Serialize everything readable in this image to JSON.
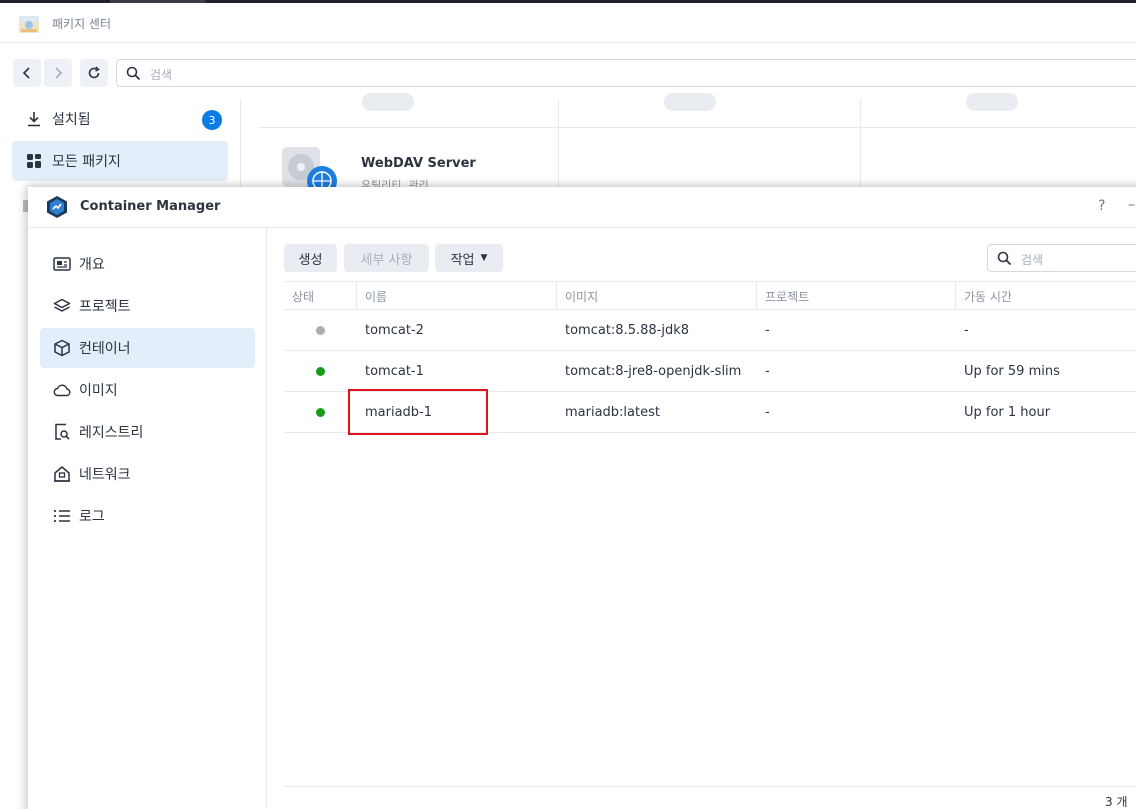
{
  "package_center": {
    "title": "패키지 센터",
    "search_placeholder": "검색",
    "sidebar": [
      {
        "label": "설치됨",
        "icon": "download-icon",
        "badge": "3"
      },
      {
        "label": "모든 패키지",
        "icon": "grid-icon",
        "active": true
      }
    ],
    "package": {
      "name": "WebDAV Server",
      "category": "유틸리티, 관리"
    }
  },
  "container_manager": {
    "title": "Container Manager",
    "help_label": "?",
    "minimize_label": "–",
    "sidebar": [
      {
        "label": "개요",
        "icon": "overview-card-icon"
      },
      {
        "label": "프로젝트",
        "icon": "layers-icon"
      },
      {
        "label": "컨테이너",
        "icon": "cube-icon",
        "active": true
      },
      {
        "label": "이미지",
        "icon": "cloud-icon"
      },
      {
        "label": "레지스트리",
        "icon": "registry-search-icon"
      },
      {
        "label": "네트워크",
        "icon": "network-house-icon"
      },
      {
        "label": "로그",
        "icon": "list-icon"
      }
    ],
    "toolbar": {
      "create_label": "생성",
      "details_label": "세부 사항",
      "action_label": "작업",
      "search_placeholder": "검색"
    },
    "table": {
      "columns": [
        "상태",
        "이름",
        "이미지",
        "프로젝트",
        "가동 시간"
      ],
      "rows": [
        {
          "status": "stopped",
          "status_color": "#a9aeb5",
          "name": "tomcat-2",
          "image": "tomcat:8.5.88-jdk8",
          "project": "-",
          "uptime": "-"
        },
        {
          "status": "running",
          "status_color": "#1a9c1a",
          "name": "tomcat-1",
          "image": "tomcat:8-jre8-openjdk-slim",
          "project": "-",
          "uptime": "Up for 59 mins"
        },
        {
          "status": "running",
          "status_color": "#1a9c1a",
          "name": "mariadb-1",
          "image": "mariadb:latest",
          "project": "-",
          "uptime": "Up for 1 hour"
        }
      ]
    },
    "footer_count": "3 개",
    "highlight_color": "#e3121b"
  }
}
